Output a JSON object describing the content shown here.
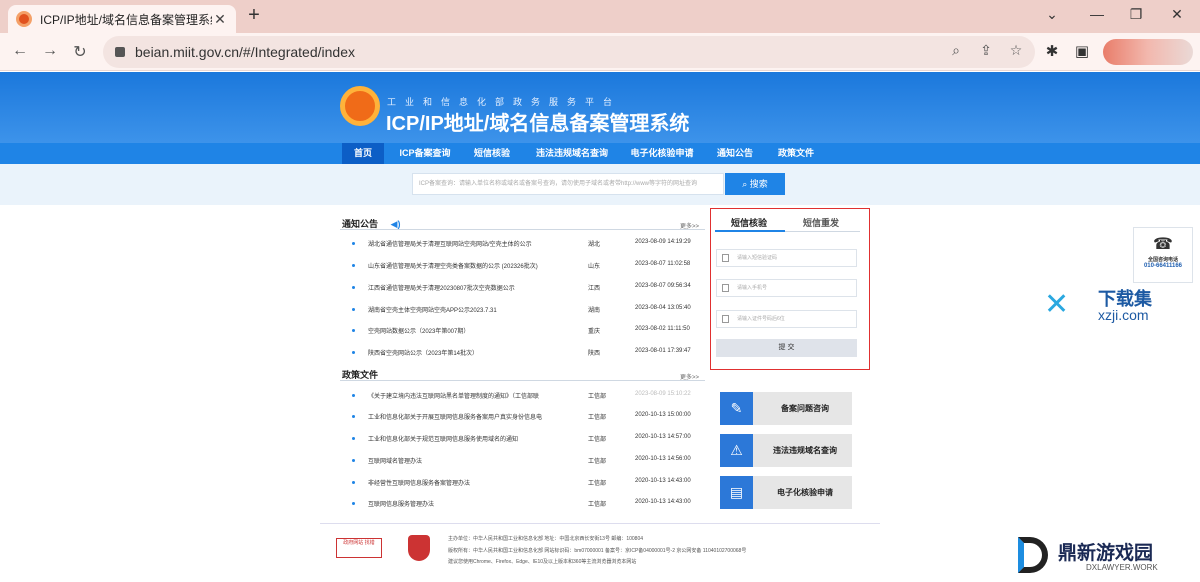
{
  "browser": {
    "tab_title": "ICP/IP地址/域名信息备案管理系统",
    "url": "beian.miit.gov.cn/#/Integrated/index"
  },
  "site": {
    "subtitle": "工业和信息化部政务服务平台",
    "title": "ICP/IP地址/域名信息备案管理系统",
    "nav": [
      "首页",
      "ICP备案查询",
      "短信核验",
      "违法违规域名查询",
      "电子化核验申请",
      "通知公告",
      "政策文件"
    ],
    "search_placeholder": "ICP备案查询：请输入单位名称或域名或备案号查询，请勿使用子域名或者带http://www等字符的网址查询",
    "search_button": "搜索"
  },
  "notices": {
    "heading": "通知公告",
    "more": "更多>>",
    "items": [
      {
        "title": "湖北省通信管理局关于清理互联网站空壳网站/空壳主体的公示",
        "region": "湖北",
        "date": "2023-08-09 14:19:29"
      },
      {
        "title": "山东省通信管理局关于清理空壳类备案数据的公示 (202326批次)",
        "region": "山东",
        "date": "2023-08-07 11:02:58"
      },
      {
        "title": "江西省通信管理局关于清理20230807批次空壳数据公示",
        "region": "江西",
        "date": "2023-08-07 09:56:34"
      },
      {
        "title": "湖南省空壳主体空壳网站空壳APP公示2023.7.31",
        "region": "湖南",
        "date": "2023-08-04 13:05:40"
      },
      {
        "title": "空壳网站数据公示（2023年第007期）",
        "region": "重庆",
        "date": "2023-08-02 11:11:50"
      },
      {
        "title": "陕西省空壳网站公示（2023年第14批次）",
        "region": "陕西",
        "date": "2023-08-01 17:39:47"
      }
    ]
  },
  "policies": {
    "heading": "政策文件",
    "more": "更多>>",
    "items": [
      {
        "title": "《关于建立境内违法互联网站黑名单管理制度的通知》（工信部联",
        "region": "工信部",
        "date": "2023-08-09 15:10:22"
      },
      {
        "title": "工业和信息化部关于开展互联网信息服务备案用户真实身份信息电",
        "region": "工信部",
        "date": "2020-10-13 15:00:00"
      },
      {
        "title": "工业和信息化部关于规范互联网信息服务使用域名的通知",
        "region": "工信部",
        "date": "2020-10-13 14:57:00"
      },
      {
        "title": "互联网域名管理办法",
        "region": "工信部",
        "date": "2020-10-13 14:56:00"
      },
      {
        "title": "非经营性互联网信息服务备案管理办法",
        "region": "工信部",
        "date": "2020-10-13 14:43:00"
      },
      {
        "title": "互联网信息服务管理办法",
        "region": "工信部",
        "date": "2020-10-13 14:43:00"
      }
    ]
  },
  "sms": {
    "tab_verify": "短信核验",
    "tab_resend": "短信重发",
    "code_placeholder": "请输入短信验证码",
    "phone_placeholder": "请输入手机号",
    "id_placeholder": "请输入证件号码后6位",
    "submit": "提 交"
  },
  "side_buttons": [
    "备案问题咨询",
    "违法违规域名查询",
    "电子化核验申请"
  ],
  "hotline": {
    "label": "全国咨询电话",
    "number": "010-66411166"
  },
  "footer": {
    "line1": "主办单位：中华人民共和国工业和信息化部      地址：中国北京西长安街13号      邮编：100804",
    "line2": "版权所有：中华人民共和国工业和信息化部      网站标识码：bm07000001      备案号：京ICP备04000001号-2      京公网安备 11040102700068号",
    "line3": "建议您使用Chrome、Firefox、Edge、IE10及以上版本和360等主流浏览器浏览本网站",
    "gov_label": "政府网站 找错"
  },
  "watermarks": {
    "xzji_text": "下载集",
    "xzji_url": "xzji.com",
    "dx_text": "鼎新游戏园",
    "dx_url": "DXLAWYER.WORK"
  }
}
